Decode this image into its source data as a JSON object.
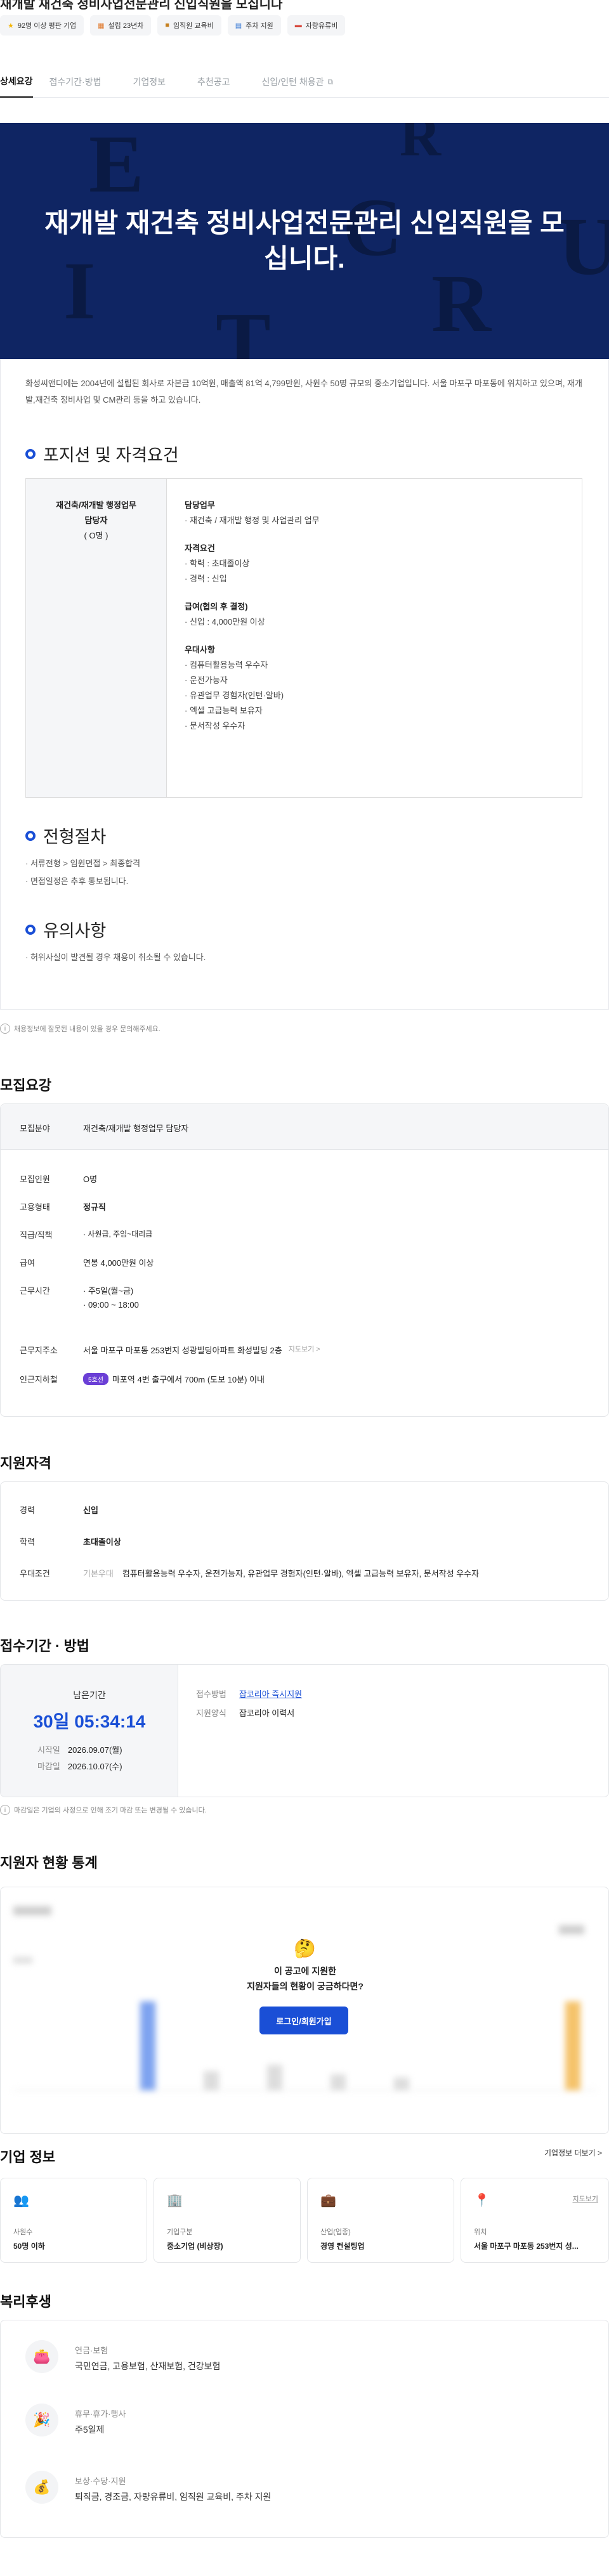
{
  "header_line": "재개발 재건축 정비사업전문관리 신입직원을 모십니다",
  "tags": [
    {
      "icon": "star-icon",
      "label": "92명 이상 평판 기업"
    },
    {
      "icon": "calendar-icon",
      "label": "설립 23년차"
    },
    {
      "icon": "book-icon",
      "label": "임직원 교육비"
    },
    {
      "icon": "chart-icon",
      "label": "주차 지원"
    },
    {
      "icon": "car-icon",
      "label": "자량유류비"
    }
  ],
  "tabs": [
    "상세요강",
    "접수기간·방법",
    "기업정보",
    "추천공고",
    "신입/인턴 채용관"
  ],
  "hero": {
    "title_line1": "재개발 재건축 정비사업전문관리 신입직원을 모",
    "title_line2": "십니다.",
    "bg_letters": [
      "E",
      "R",
      "C",
      "U",
      "I",
      "T",
      "R"
    ]
  },
  "intro": "화성씨앤디에는 2004년에 설립된 회사로 자본금 10억원, 매출액 81억 4,799만원, 사원수 50명 규모의 중소기업입니다. 서울 마포구 마포동에 위치하고 있으며, 재개발,재건축 정비사업 및 CM관리 등을 하고 있습니다.",
  "sections": {
    "position": "포지션 및 자격요건",
    "process": "전형절차",
    "notice": "유의사항"
  },
  "qualification": {
    "role_line1": "재건축/재개발 행정업무",
    "role_line2": "담당자",
    "role_count": "( O명 )",
    "groups": [
      {
        "title": "담당업무",
        "items": [
          "· 재건축 / 재개발 행정 및 사업관리 업무"
        ]
      },
      {
        "title": "자격요건",
        "items": [
          "· 학력 : 초대졸이상",
          "· 경력 : 신입"
        ]
      },
      {
        "title": "급여(협의 후 결정)",
        "items": [
          "· 신입 : 4,000만원 이상"
        ]
      },
      {
        "title": "우대사항",
        "items": [
          "· 컴퓨터활용능력 우수자",
          "· 운전가능자",
          "· 유관업무 경험자(인턴·알바)",
          "· 엑셀 고급능력 보유자",
          "· 문서작성 우수자"
        ]
      }
    ]
  },
  "process_items": [
    "· 서류전형 > 임원면접 > 최종합격",
    "· 면접일정은 추후 통보됩니다."
  ],
  "notice_items": [
    "· 허위사실이 발견될 경우 채용이 취소될 수 있습니다."
  ],
  "footnote1": "채용정보에 잘못된 내용이 있을 경우 문의해주세요.",
  "recruit": {
    "heading": "모집요강",
    "field_label": "모집분야",
    "field_value": "재건축/재개발 행정업무 담당자",
    "rows": [
      {
        "k": "모집인원",
        "v": "O명"
      },
      {
        "k": "고용형태",
        "v": "정규직"
      },
      {
        "k": "직급/직책",
        "v": "· 사원급, 주임~대리급"
      },
      {
        "k": "급여",
        "v": "연봉 4,000만원 이상"
      },
      {
        "k": "근무시간",
        "v": "· 주5일(월~금)"
      },
      {
        "k": "근무지주소",
        "v": "서울 마포구 마포동 253번지 성광빌딩아파트 화성빌딩 2층"
      },
      {
        "k": "인근지하철",
        "v": "마포역 4번 출구에서 700m (도보 10분) 이내"
      }
    ],
    "work_hours": "· 09:00 ~ 18:00",
    "map_link": "지도보기 >",
    "subway_badge": "5호선"
  },
  "apply_qual": {
    "heading": "지원자격",
    "career_label": "경력",
    "career_value": "신입",
    "edu_label": "학력",
    "edu_value": "초대졸이상",
    "pref_label": "우대조건",
    "pref_sub": "기본우대",
    "pref_value": "컴퓨터활용능력 우수자, 운전가능자, 유관업무 경험자(인턴·알바), 엑셀 고급능력 보유자, 문서작성 우수자"
  },
  "period": {
    "heading": "접수기간 · 방법",
    "remaining_label": "남은기간",
    "remaining": "30일 05:34:14",
    "start_label": "시작일",
    "start": "2026.09.07(월)",
    "end_label": "마감일",
    "end": "2026.10.07(수)",
    "method_label": "접수방법",
    "method_value": "잡코리아 즉시지원",
    "form_label": "지원양식",
    "form_value": "잡코리아 이력서",
    "footnote": "마감일은 기업의 사정으로 인해 조기 마감 또는 변경될 수 있습니다."
  },
  "stats": {
    "heading": "지원자 현황 통계",
    "prompt_line1": "이 공고에 지원한",
    "prompt_line2": "지원자들의 현황이 궁금하다면?",
    "prompt_highlight": "지원자들의 현황",
    "button": "로그인/회원가입"
  },
  "company": {
    "heading": "기업 정보",
    "more": "기업정보 더보기 >",
    "cards": [
      {
        "icon": "people-icon",
        "title": "사원수",
        "value": "50명 이하"
      },
      {
        "icon": "building-icon",
        "title": "기업구분",
        "value": "중소기업 (비상장)"
      },
      {
        "icon": "briefcase-icon",
        "title": "산업(업종)",
        "value": "경영 컨설팅업"
      },
      {
        "icon": "location-icon",
        "title": "위치",
        "value": "서울 마포구 마포동 253번지 성...",
        "extra": "지도보기"
      }
    ]
  },
  "welfare": {
    "heading": "복리후생",
    "items": [
      {
        "icon": "wallet-icon",
        "title": "연금·보험",
        "value": "국민연금, 고용보험, 산재보험, 건강보험"
      },
      {
        "icon": "party-icon",
        "title": "휴무·휴가·행사",
        "value": "주5일제"
      },
      {
        "icon": "moneybag-icon",
        "title": "보상·수당·지원",
        "value": "퇴직금, 경조금, 자량유류비, 임직원 교육비, 주차 지원"
      }
    ]
  },
  "colors": {
    "navy": "#0f2563",
    "blue": "#1a4fd6",
    "purple": "#6b3fd6"
  }
}
